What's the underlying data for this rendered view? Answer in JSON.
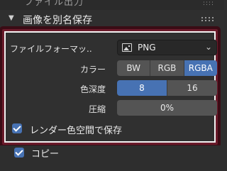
{
  "top_partial": {
    "text": "ファイル出力",
    "dots": "::::"
  },
  "panel": {
    "title": "画像を別名保存",
    "collapse_arrow": "▼"
  },
  "file_format": {
    "label": "ファイルフォーマッ..",
    "value": "PNG",
    "icon": "image-icon",
    "chevron": "⌄"
  },
  "color": {
    "label": "カラー",
    "options": [
      "BW",
      "RGB",
      "RGBA"
    ],
    "selected": "RGBA"
  },
  "color_depth": {
    "label": "色深度",
    "options": [
      "8",
      "16"
    ],
    "selected": "8"
  },
  "compression": {
    "label": "圧縮",
    "value": "0%"
  },
  "save_in_render_space": {
    "label": "レンダー色空間で保存",
    "checked": true
  },
  "copy": {
    "label": "コピー",
    "checked": true
  },
  "colors": {
    "accent": "#4772b3",
    "highlight_border": "#6b1b2b",
    "field_bg": "#545454",
    "panel_bg": "#2e2e2e"
  }
}
